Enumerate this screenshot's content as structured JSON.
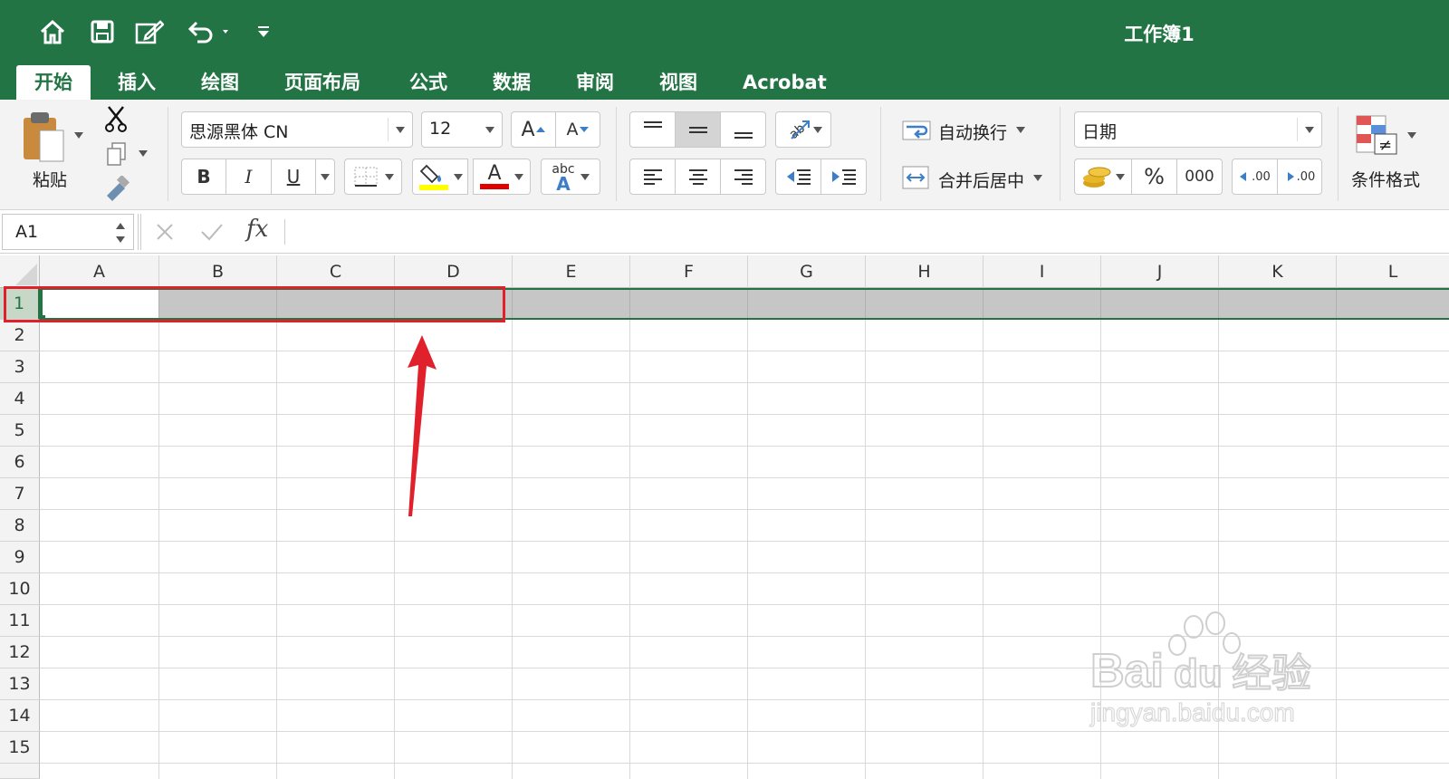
{
  "window": {
    "title": "工作簿1"
  },
  "quick_access": [
    "home-icon",
    "save-icon",
    "edit-icon",
    "undo-icon",
    "customize-icon"
  ],
  "tabs": [
    {
      "label": "开始",
      "active": true
    },
    {
      "label": "插入"
    },
    {
      "label": "绘图"
    },
    {
      "label": "页面布局"
    },
    {
      "label": "公式"
    },
    {
      "label": "数据"
    },
    {
      "label": "审阅"
    },
    {
      "label": "视图"
    },
    {
      "label": "Acrobat"
    }
  ],
  "clipboard": {
    "paste_label": "粘贴"
  },
  "font": {
    "name": "思源黑体 CN",
    "size": "12",
    "grow": "A",
    "shrink": "A",
    "bold": "B",
    "italic": "I",
    "underline": "U",
    "font_color_glyph": "A",
    "phonetic_glyph": "abc",
    "phonetic_letter": "A",
    "fill_color": "#ffff00",
    "font_color": "#e00000"
  },
  "alignment": {
    "wrap_text": "自动换行",
    "merge_center": "合并后居中"
  },
  "number": {
    "format": "日期",
    "percent": "%",
    "comma": "000",
    "increase_decimal": ".00",
    "decrease_decimal": ".00"
  },
  "styles": {
    "conditional_format": "条件格式"
  },
  "formula_bar": {
    "name_box": "A1",
    "fx": "fx",
    "value": ""
  },
  "grid": {
    "columns": [
      "A",
      "B",
      "C",
      "D",
      "E",
      "F",
      "G",
      "H",
      "I",
      "J",
      "K",
      "L"
    ],
    "rows": [
      "1",
      "2",
      "3",
      "4",
      "5",
      "6",
      "7",
      "8",
      "9",
      "10",
      "11",
      "12",
      "13",
      "14",
      "15"
    ],
    "selected_row": "1",
    "active_cell": "A1",
    "highlighted_range": "A1:D1"
  },
  "colors": {
    "accent": "#237445",
    "selection_fill": "#c6c6c6",
    "annotation": "#e0212b"
  },
  "watermark": {
    "brand": "Bai du 经验",
    "url": "jingyan.baidu.com"
  }
}
